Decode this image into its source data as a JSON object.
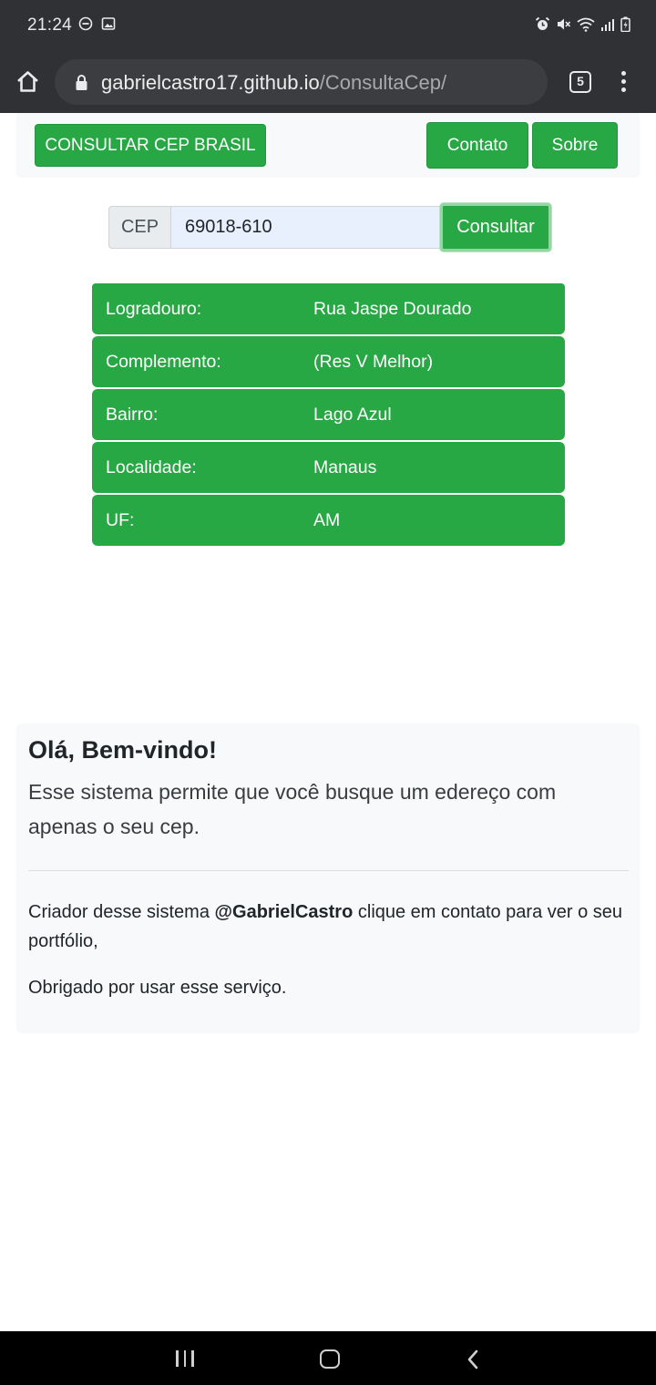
{
  "status_bar": {
    "time": "21:24",
    "left_icons": [
      "do-not-disturb-icon",
      "image-icon"
    ],
    "right_icons": [
      "alarm-icon",
      "mute-icon",
      "wifi-icon",
      "signal-icon",
      "battery-icon"
    ]
  },
  "browser": {
    "url_host": "gabrielcastro17.github.io",
    "url_path": "/ConsultaCep/",
    "tab_count": "5"
  },
  "navbar": {
    "brand": "CONSULTAR CEP BRASIL",
    "contato": "Contato",
    "sobre": "Sobre"
  },
  "search": {
    "prepend": "CEP",
    "value": "69018-610",
    "button": "Consultar"
  },
  "results": [
    {
      "label": "Logradouro:",
      "value": "Rua Jaspe Dourado"
    },
    {
      "label": "Complemento:",
      "value": "(Res V Melhor)"
    },
    {
      "label": "Bairro:",
      "value": "Lago Azul"
    },
    {
      "label": "Localidade:",
      "value": "Manaus"
    },
    {
      "label": "UF:",
      "value": "AM"
    }
  ],
  "welcome": {
    "title": "Olá, Bem-vindo!",
    "lead": "Esse sistema permite que você busque um edereço com apenas o seu cep.",
    "creator_prefix": "Criador desse sistema ",
    "creator_name": "@GabrielCastro",
    "creator_suffix": " clique em contato para ver o seu portfólio,",
    "thanks": "Obrigado por usar esse serviço."
  },
  "colors": {
    "primary_green": "#28a745",
    "chrome_dark": "#303134",
    "light_panel": "#f8f9fa",
    "autofill_blue": "#e8f0fe"
  }
}
